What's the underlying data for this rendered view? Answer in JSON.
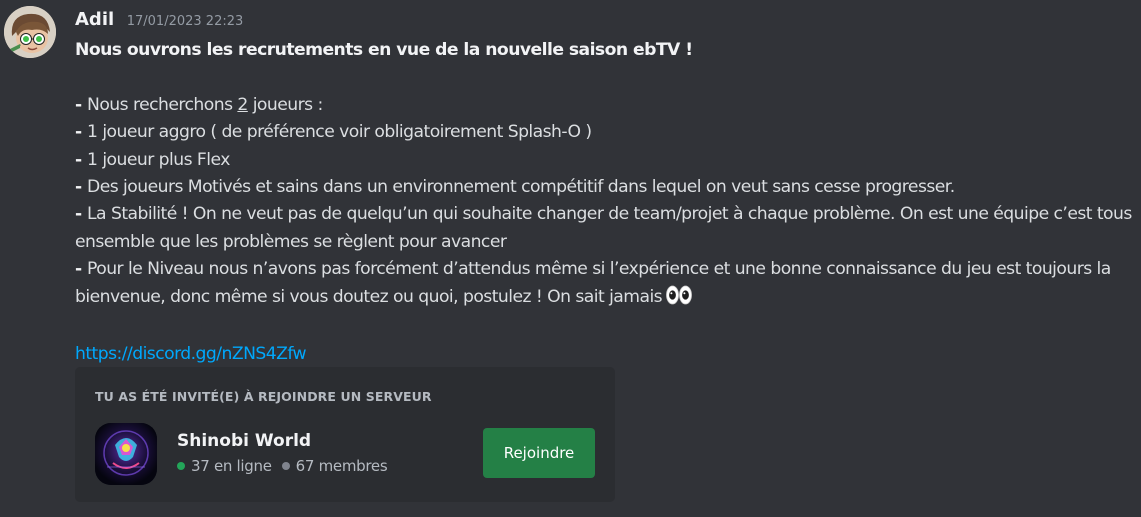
{
  "message": {
    "author": "Adil",
    "timestamp": "17/01/2023 22:23",
    "headline": "Nous ouvrons les recrutements en vue de la nouvelle saison ebTV !",
    "lines": [
      {
        "dash": "- ",
        "pre": "Nous recherchons ",
        "underlined": "2",
        "post": " joueurs :"
      },
      {
        "dash": "- ",
        "text": "1 joueur aggro ( de préférence voir obligatoirement Splash-O )"
      },
      {
        "dash": "- ",
        "text": "1 joueur plus Flex"
      },
      {
        "dash": "- ",
        "text": "Des joueurs Motivés et sains dans un environnement compétitif dans lequel on veut sans cesse progresser."
      },
      {
        "dash": "- ",
        "text": "La Stabilité ! On ne veut pas de quelqu’un qui souhaite changer de team/projet à chaque problème. On est une équipe c’est tous ensemble que les problèmes se règlent pour avancer"
      },
      {
        "dash": "- ",
        "text": "Pour le Niveau nous n’avons pas forcément d’attendus même si l’expérience et une bonne connaissance du jeu est toujours la bienvenue, donc même si vous doutez ou quoi, postulez ! On sait jamais"
      }
    ],
    "eyes_icon": "eyes-emoji",
    "link": "https://discord.gg/nZNS4Zfw"
  },
  "invite": {
    "title": "TU AS ÉTÉ INVITÉ(E) À REJOINDRE UN SERVEUR",
    "server_name": "Shinobi World",
    "online": "37 en ligne",
    "members": "67 membres",
    "join_label": "Rejoindre",
    "colors": {
      "online_dot": "#23a559",
      "members_dot": "#80848e",
      "join_button": "#248046"
    }
  }
}
